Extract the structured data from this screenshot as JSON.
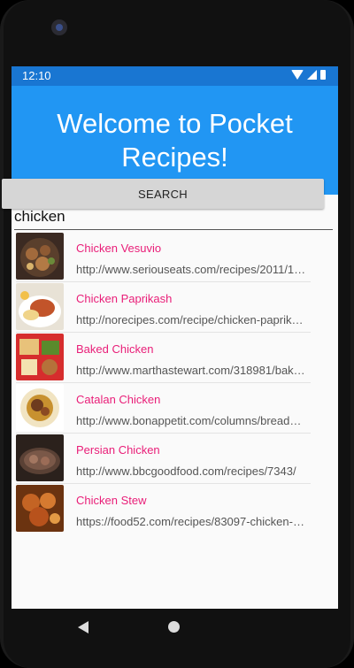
{
  "status_bar": {
    "time": "12:10"
  },
  "header": {
    "title": "Welcome to Pocket Recipes!"
  },
  "search": {
    "value": "chicken",
    "button_label": "SEARCH"
  },
  "results": [
    {
      "title": "Chicken Vesuvio",
      "url": "http://www.seriouseats.com/recipes/2011/1…",
      "thumb_icon": "chicken-vesuvio-image"
    },
    {
      "title": "Chicken Paprikash",
      "url": "http://norecipes.com/recipe/chicken-paprika…",
      "thumb_icon": "chicken-paprikash-image"
    },
    {
      "title": "Baked Chicken",
      "url": "http://www.marthastewart.com/318981/bak…",
      "thumb_icon": "baked-chicken-image"
    },
    {
      "title": "Catalan Chicken",
      "url": "http://www.bonappetit.com/columns/bread…",
      "thumb_icon": "catalan-chicken-image"
    },
    {
      "title": "Persian Chicken",
      "url": "http://www.bbcgoodfood.com/recipes/7343/",
      "thumb_icon": "persian-chicken-image"
    },
    {
      "title": "Chicken Stew",
      "url": "https://food52.com/recipes/83097-chicken-s…",
      "thumb_icon": "chicken-stew-image"
    }
  ],
  "colors": {
    "status_bar": "#1976d2",
    "header": "#2196f3",
    "title_text": "#e91e78"
  }
}
